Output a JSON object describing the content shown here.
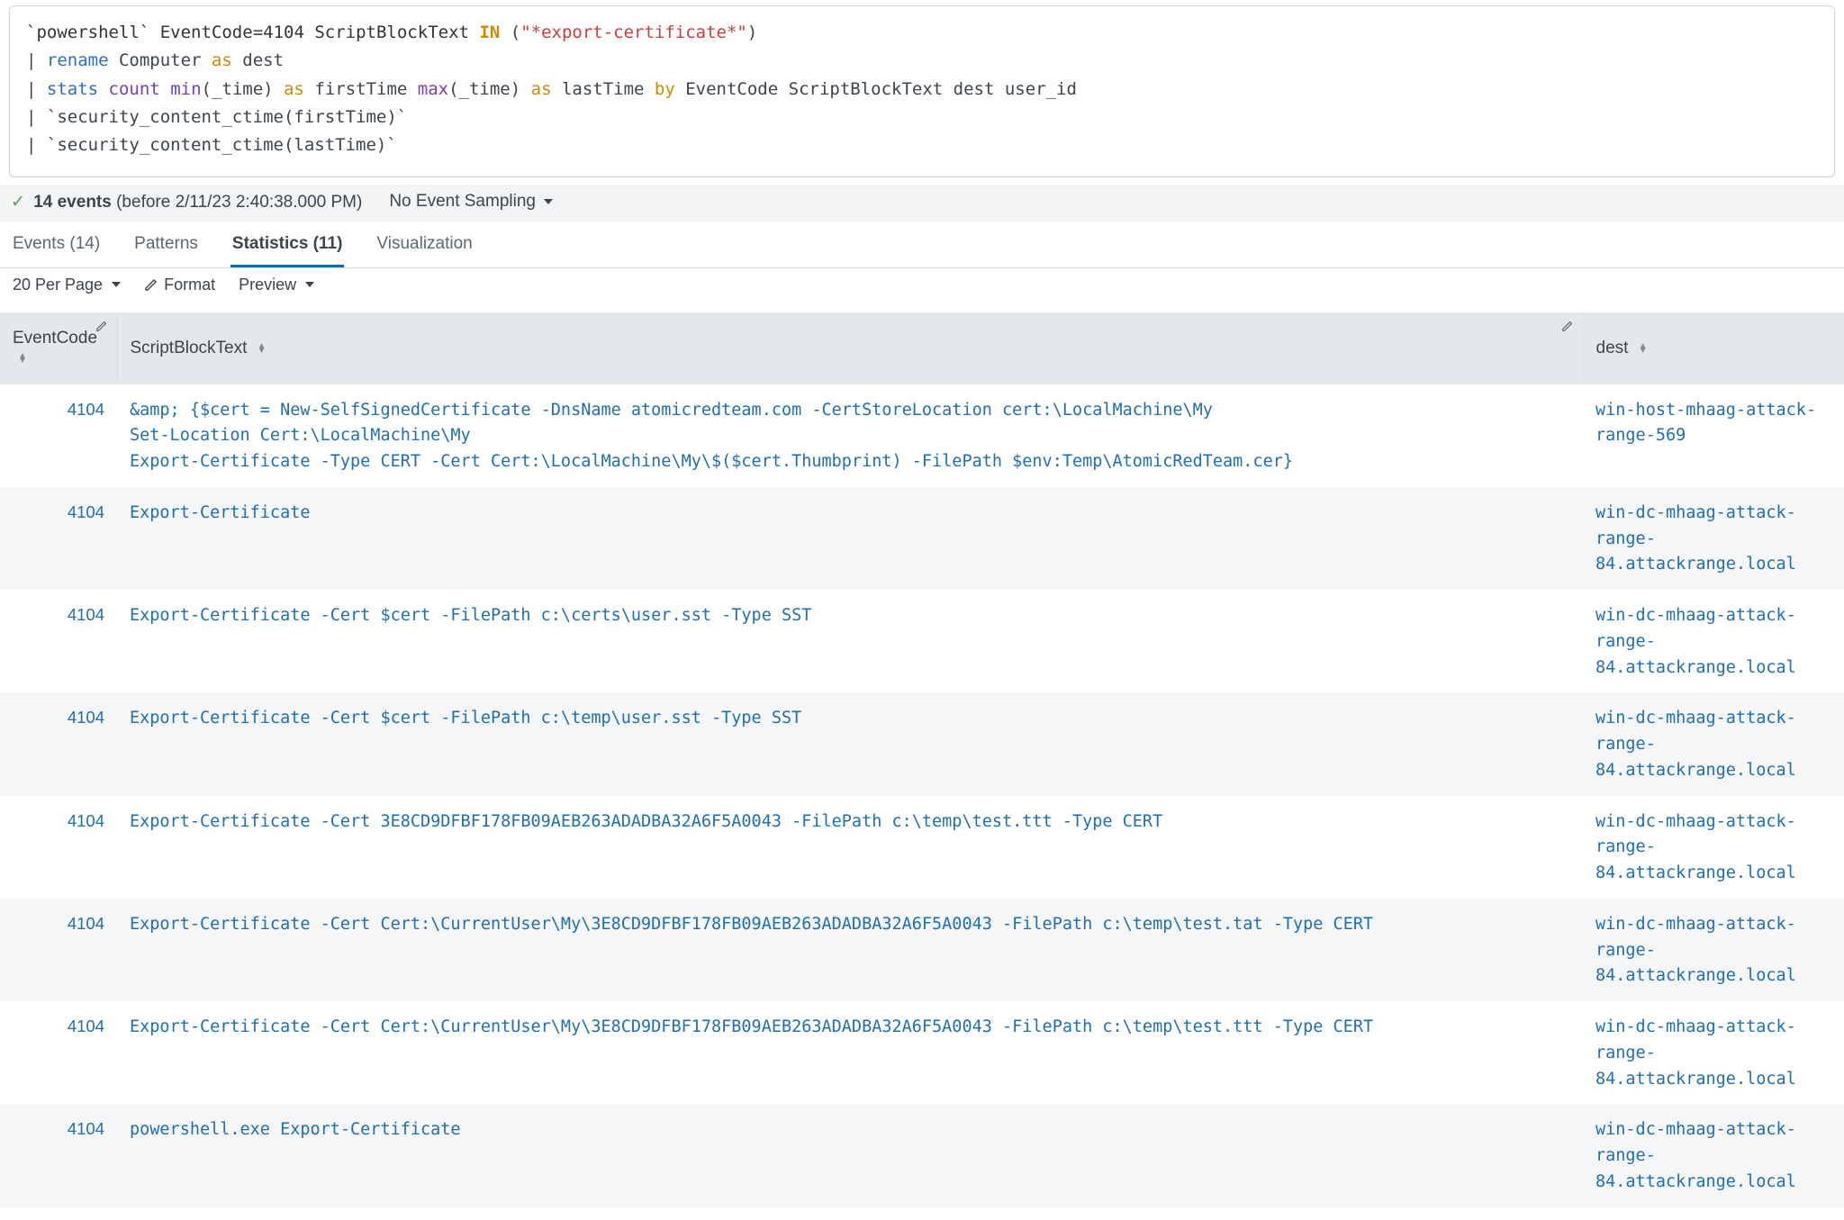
{
  "search": {
    "tokens": [
      [
        {
          "t": "name",
          "v": "`powershell`"
        },
        {
          "t": "raw",
          "v": " "
        },
        {
          "t": "name",
          "v": "EventCode"
        },
        {
          "t": "raw",
          "v": "="
        },
        {
          "t": "num",
          "v": "4104"
        },
        {
          "t": "raw",
          "v": " "
        },
        {
          "t": "name",
          "v": "ScriptBlockText"
        },
        {
          "t": "raw",
          "v": " "
        },
        {
          "t": "in",
          "v": "IN"
        },
        {
          "t": "raw",
          "v": " ("
        },
        {
          "t": "str",
          "v": "\"*export-certificate*\""
        },
        {
          "t": "raw",
          "v": ")"
        }
      ],
      [
        {
          "t": "raw",
          "v": "| "
        },
        {
          "t": "cmd",
          "v": "rename"
        },
        {
          "t": "raw",
          "v": " Computer "
        },
        {
          "t": "as",
          "v": "as"
        },
        {
          "t": "raw",
          "v": " dest"
        }
      ],
      [
        {
          "t": "raw",
          "v": "| "
        },
        {
          "t": "cmd",
          "v": "stats"
        },
        {
          "t": "raw",
          "v": " "
        },
        {
          "t": "func",
          "v": "count"
        },
        {
          "t": "raw",
          "v": " "
        },
        {
          "t": "func",
          "v": "min"
        },
        {
          "t": "raw",
          "v": "(_time) "
        },
        {
          "t": "as",
          "v": "as"
        },
        {
          "t": "raw",
          "v": " firstTime "
        },
        {
          "t": "func",
          "v": "max"
        },
        {
          "t": "raw",
          "v": "(_time) "
        },
        {
          "t": "as",
          "v": "as"
        },
        {
          "t": "raw",
          "v": " lastTime "
        },
        {
          "t": "by",
          "v": "by"
        },
        {
          "t": "raw",
          "v": " EventCode ScriptBlockText dest user_id"
        }
      ],
      [
        {
          "t": "raw",
          "v": "| `security_content_ctime(firstTime)`"
        }
      ],
      [
        {
          "t": "raw",
          "v": "| `security_content_ctime(lastTime)`"
        }
      ]
    ]
  },
  "meta": {
    "check": "✓",
    "count_label": "14 events",
    "time_label": " (before 2/11/23 2:40:38.000 PM)",
    "sampling": "No Event Sampling"
  },
  "tabs": [
    {
      "label": "Events (14)",
      "active": false
    },
    {
      "label": "Patterns",
      "active": false
    },
    {
      "label": "Statistics (11)",
      "active": true
    },
    {
      "label": "Visualization",
      "active": false
    }
  ],
  "toolbar": {
    "per_page": "20 Per Page",
    "format": "Format",
    "preview": "Preview"
  },
  "columns": {
    "event": "EventCode",
    "script": "ScriptBlockText",
    "dest": "dest"
  },
  "rows": [
    {
      "event": "4104",
      "script": "&amp; {$cert = New-SelfSignedCertificate -DnsName atomicredteam.com -CertStoreLocation cert:\\LocalMachine\\My\nSet-Location Cert:\\LocalMachine\\My\nExport-Certificate -Type CERT -Cert Cert:\\LocalMachine\\My\\$($cert.Thumbprint) -FilePath $env:Temp\\AtomicRedTeam.cer}",
      "dest": "win-host-mhaag-attack-range-569"
    },
    {
      "event": "4104",
      "script": "Export-Certificate",
      "dest": "win-dc-mhaag-attack-range-84.attackrange.local"
    },
    {
      "event": "4104",
      "script": "Export-Certificate -Cert $cert -FilePath c:\\certs\\user.sst -Type SST",
      "dest": "win-dc-mhaag-attack-range-84.attackrange.local"
    },
    {
      "event": "4104",
      "script": "Export-Certificate -Cert $cert -FilePath c:\\temp\\user.sst -Type SST",
      "dest": "win-dc-mhaag-attack-range-84.attackrange.local"
    },
    {
      "event": "4104",
      "script": "Export-Certificate -Cert 3E8CD9DFBF178FB09AEB263ADADBA32A6F5A0043 -FilePath c:\\temp\\test.ttt -Type CERT",
      "dest": "win-dc-mhaag-attack-range-84.attackrange.local"
    },
    {
      "event": "4104",
      "script": "Export-Certificate -Cert Cert:\\CurrentUser\\My\\3E8CD9DFBF178FB09AEB263ADADBA32A6F5A0043 -FilePath c:\\temp\\test.tat -Type CERT",
      "dest": "win-dc-mhaag-attack-range-84.attackrange.local"
    },
    {
      "event": "4104",
      "script": "Export-Certificate -Cert Cert:\\CurrentUser\\My\\3E8CD9DFBF178FB09AEB263ADADBA32A6F5A0043 -FilePath c:\\temp\\test.ttt -Type CERT",
      "dest": "win-dc-mhaag-attack-range-84.attackrange.local"
    },
    {
      "event": "4104",
      "script": "powershell.exe Export-Certificate",
      "dest": "win-dc-mhaag-attack-range-84.attackrange.local"
    }
  ]
}
